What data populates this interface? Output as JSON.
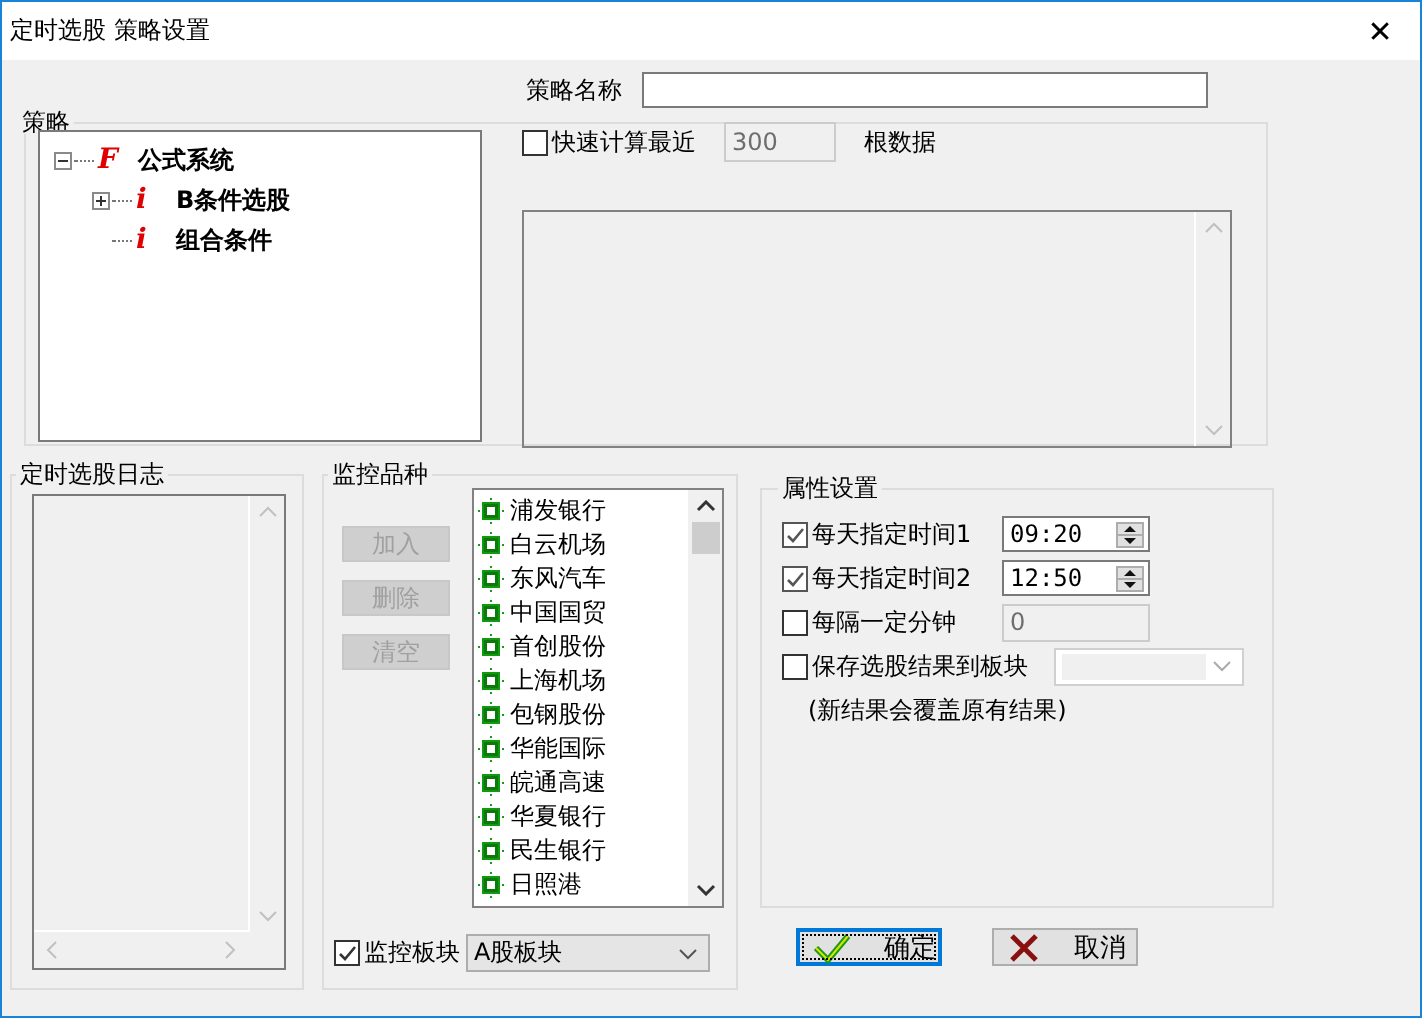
{
  "window": {
    "title": "定时选股 策略设置",
    "close": "✕"
  },
  "strategy_name": {
    "label": "策略名称"
  },
  "strategy": {
    "title": "策略",
    "tree": [
      {
        "marker": "F",
        "label": "公式系统",
        "expanded": true,
        "children": [
          {
            "marker": "i",
            "label": "B条件选股",
            "expanded": false
          },
          {
            "marker": "i",
            "label": "组合条件"
          }
        ]
      }
    ],
    "fast_calc": {
      "label": "快速计算最近",
      "checked": false,
      "value": "300",
      "suffix": "根数据"
    }
  },
  "log": {
    "title": "定时选股日志"
  },
  "monitor": {
    "title": "监控品种",
    "buttons": [
      {
        "label": "加入",
        "disabled": true
      },
      {
        "label": "删除",
        "disabled": true
      },
      {
        "label": "清空",
        "disabled": true
      }
    ],
    "stocks": [
      "浦发银行",
      "白云机场",
      "东风汽车",
      "中国国贸",
      "首创股份",
      "上海机场",
      "包钢股份",
      "华能国际",
      "皖通高速",
      "华夏银行",
      "民生银行",
      "日照港"
    ],
    "board": {
      "label": "监控板块",
      "checked": true,
      "value": "A股板块"
    }
  },
  "properties": {
    "title": "属性设置",
    "rows": [
      {
        "kind": "time",
        "label": "每天指定时间1",
        "checked": true,
        "value": "09:20"
      },
      {
        "kind": "time",
        "label": "每天指定时间2",
        "checked": true,
        "value": "12:50"
      },
      {
        "kind": "number",
        "label": "每隔一定分钟",
        "checked": false,
        "value": "0"
      },
      {
        "kind": "select",
        "label": "保存选股结果到板块",
        "checked": false
      }
    ],
    "note": "(新结果会覆盖原有结果)"
  },
  "buttons": [
    {
      "kind": "ok",
      "label": "确定",
      "focused": true
    },
    {
      "kind": "cancel",
      "label": "取消",
      "focused": false
    }
  ]
}
